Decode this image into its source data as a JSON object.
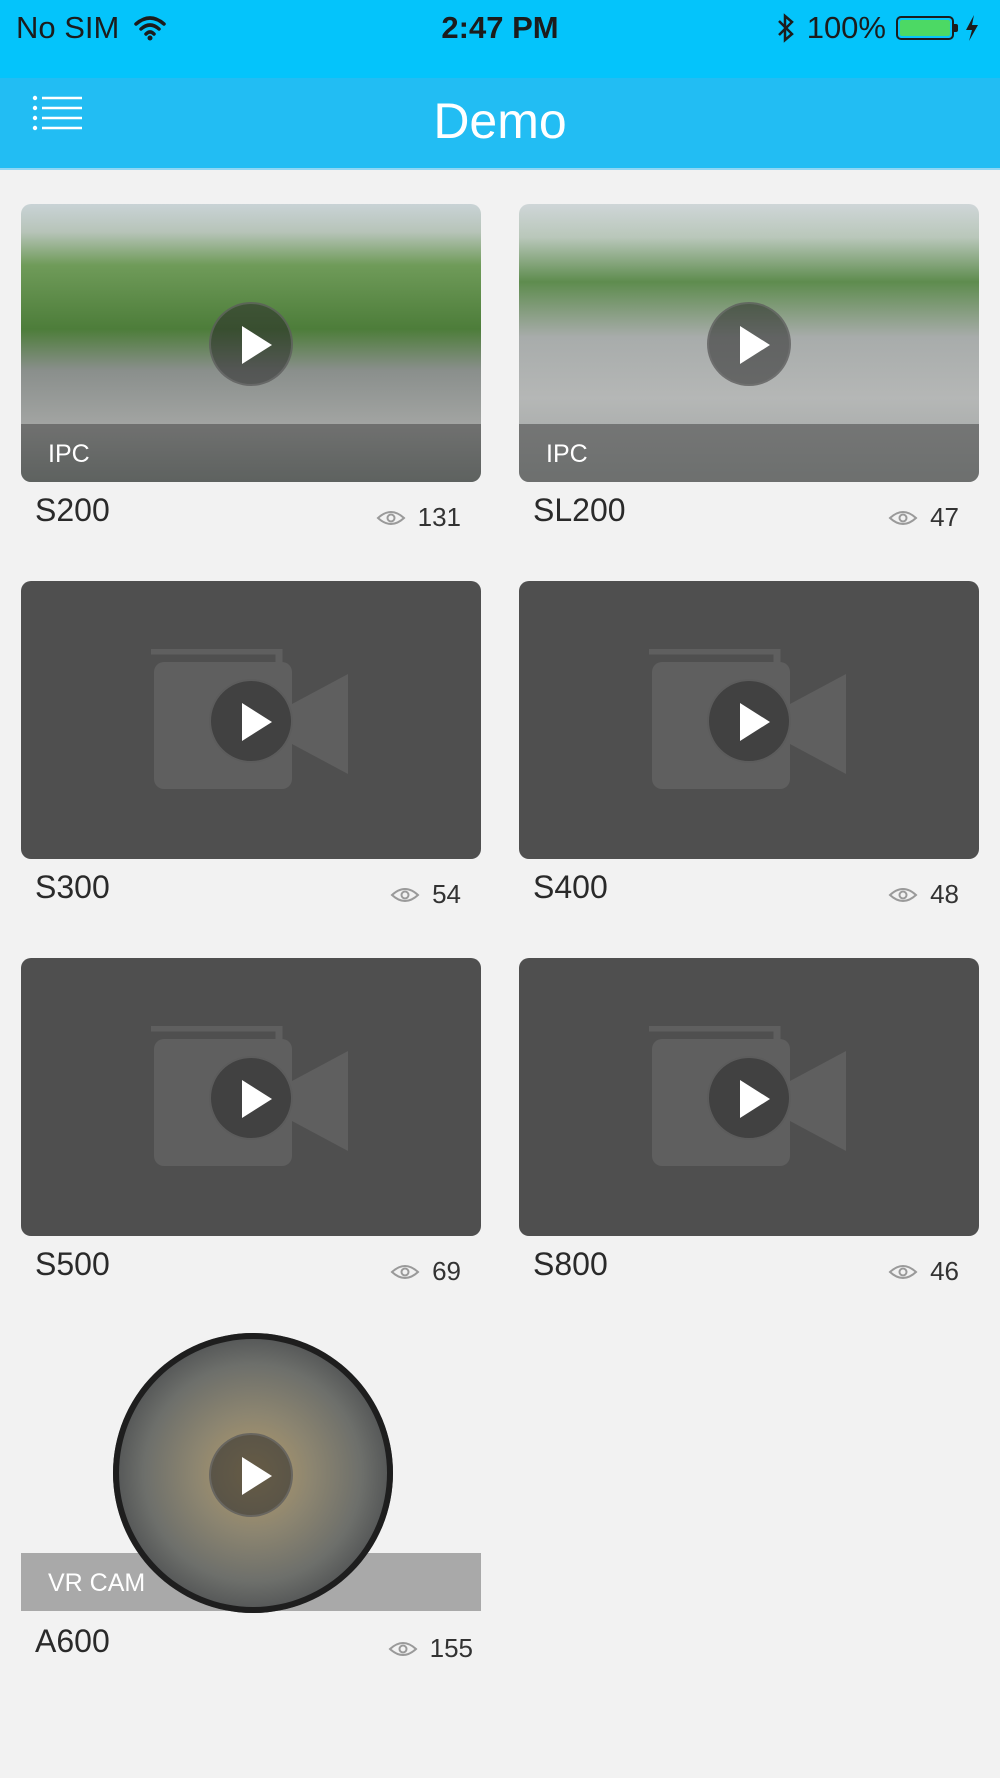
{
  "status_bar": {
    "carrier": "No SIM",
    "time": "2:47 PM",
    "battery": "100%",
    "battery_level": 1.0
  },
  "header": {
    "title": "Demo"
  },
  "devices": [
    {
      "name": "S200",
      "views": "131",
      "tag": "IPC"
    },
    {
      "name": "SL200",
      "views": "47",
      "tag": "IPC"
    },
    {
      "name": "S300",
      "views": "54"
    },
    {
      "name": "S400",
      "views": "48"
    },
    {
      "name": "S500",
      "views": "69"
    },
    {
      "name": "S800",
      "views": "46"
    },
    {
      "name": "A600",
      "views": "155",
      "tag": "VR CAM"
    }
  ],
  "colors": {
    "status_bar": "#04c4fb",
    "nav_bar": "#22bdf3",
    "placeholder": "#4f4f4f",
    "background": "#f2f2f2"
  },
  "icons": {
    "menu": "menu-list-icon",
    "wifi": "wifi-icon",
    "bluetooth": "bluetooth-icon",
    "battery": "battery-icon",
    "charging": "charging-bolt-icon",
    "play": "play-icon",
    "views": "eye-icon",
    "placeholder": "video-camera-icon"
  }
}
